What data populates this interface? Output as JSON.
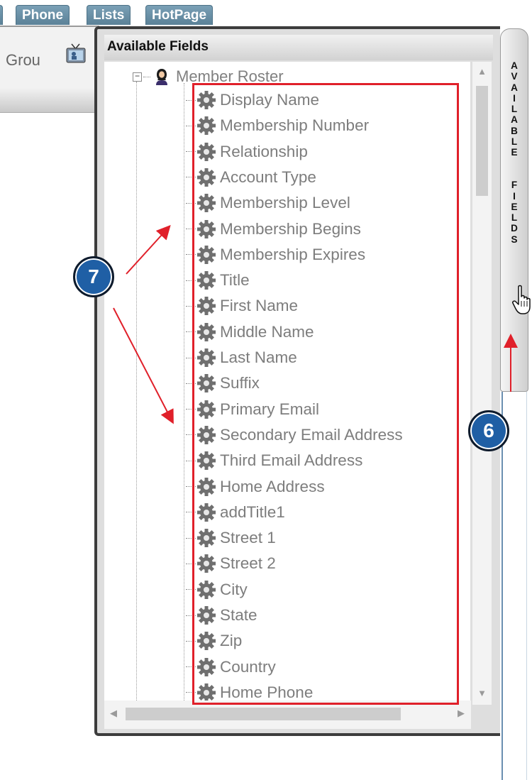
{
  "tabs": [
    {
      "label": "Phone"
    },
    {
      "label": "Lists"
    },
    {
      "label": "HotPage"
    }
  ],
  "background_window": {
    "group_label": "Grou"
  },
  "panel": {
    "title": "Available Fields",
    "root_label": "Member Roster",
    "fields": [
      "Display Name",
      "Membership Number",
      "Relationship",
      "Account Type",
      "Membership Level",
      "Membership Begins",
      "Membership Expires",
      "Title",
      "First Name",
      "Middle Name",
      "Last Name",
      "Suffix",
      "Primary Email",
      "Secondary Email Address",
      "Third Email Address",
      "Home Address",
      "addTitle1",
      "Street 1",
      "Street 2",
      "City",
      "State",
      "Zip",
      "Country",
      "Home Phone"
    ]
  },
  "side_tab": {
    "label": "AVAILABLE FIELDS"
  },
  "callouts": {
    "step_fields": "7",
    "step_sidetab": "6"
  },
  "colors": {
    "annotation_red": "#e0202a",
    "badge_blue": "#1f5fa5",
    "tab_blue": "#6a90a6"
  }
}
